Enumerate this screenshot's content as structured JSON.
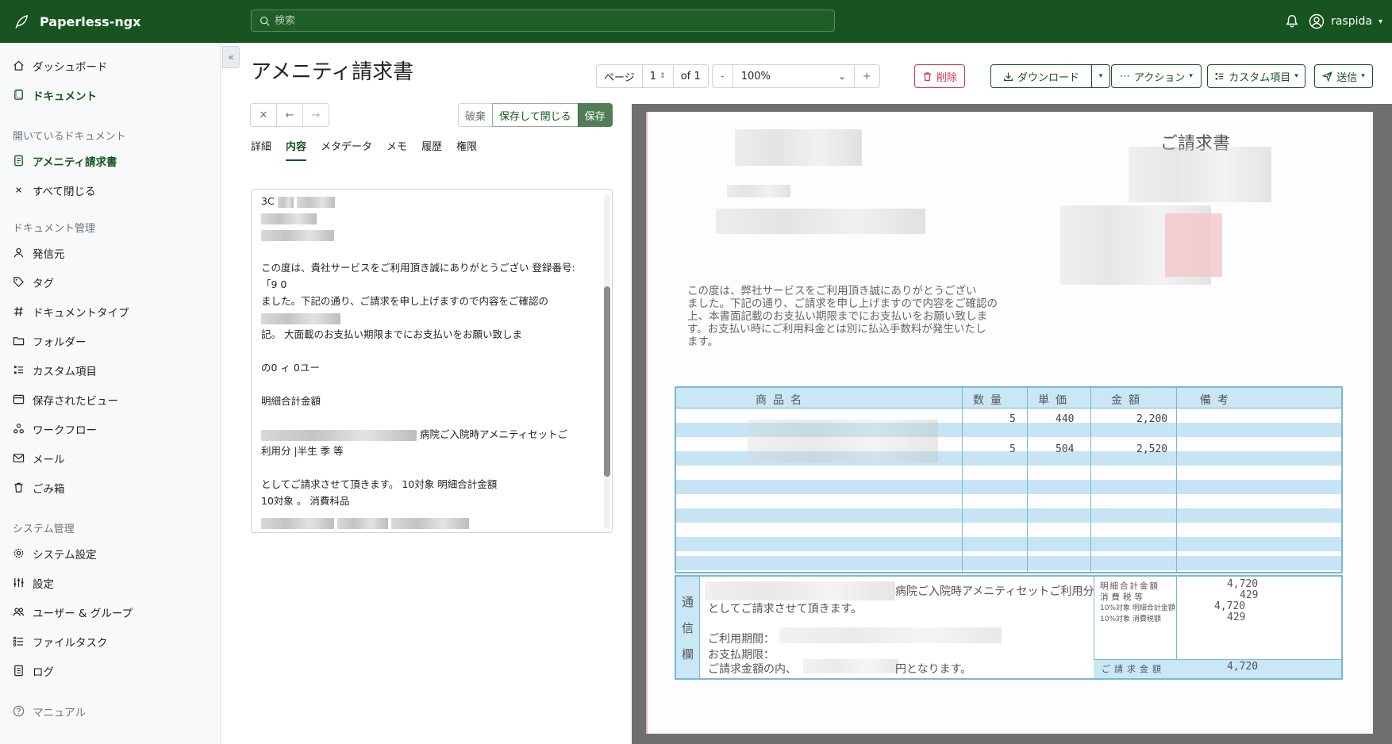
{
  "app": {
    "name": "Paperless-ngx"
  },
  "search": {
    "placeholder": "検索"
  },
  "user": {
    "name": "raspida"
  },
  "sidebar": {
    "top": [
      {
        "label": "ダッシュボード",
        "icon": "house-icon"
      },
      {
        "label": "ドキュメント",
        "icon": "document-icon"
      }
    ],
    "open_docs_header": "開いているドキュメント",
    "open_docs": [
      {
        "label": "アメニティ請求書",
        "icon": "file-text-icon"
      },
      {
        "label": "すべて閉じる",
        "icon": "close-icon"
      }
    ],
    "manage_header": "ドキュメント管理",
    "manage": [
      {
        "label": "発信元",
        "icon": "person-icon"
      },
      {
        "label": "タグ",
        "icon": "tag-icon"
      },
      {
        "label": "ドキュメントタイプ",
        "icon": "hash-icon"
      },
      {
        "label": "フォルダー",
        "icon": "folder-icon"
      },
      {
        "label": "カスタム項目",
        "icon": "custom-fields-icon"
      },
      {
        "label": "保存されたビュー",
        "icon": "saved-views-icon"
      },
      {
        "label": "ワークフロー",
        "icon": "workflow-icon"
      },
      {
        "label": "メール",
        "icon": "mail-icon"
      },
      {
        "label": "ごみ箱",
        "icon": "trash-icon"
      }
    ],
    "system_header": "システム管理",
    "system": [
      {
        "label": "システム設定",
        "icon": "gear-icon"
      },
      {
        "label": "設定",
        "icon": "sliders-icon"
      },
      {
        "label": "ユーザー & グループ",
        "icon": "people-icon"
      },
      {
        "label": "ファイルタスク",
        "icon": "list-task-icon"
      },
      {
        "label": "ログ",
        "icon": "log-icon"
      }
    ],
    "manual": {
      "label": "マニュアル",
      "icon": "question-icon"
    }
  },
  "document": {
    "title": "アメニティ請求書",
    "pager": {
      "page_label": "ページ",
      "page_value": "1",
      "of_label": "of 1"
    },
    "zoom": {
      "minus": "-",
      "value": "100%",
      "plus": "+"
    },
    "buttons": {
      "delete": "削除",
      "download": "ダウンロード",
      "actions": "アクション",
      "custom_fields": "カスタム項目",
      "send": "送信",
      "discard": "破棄",
      "save_close": "保存して閉じる",
      "save": "保存"
    },
    "tabs": [
      "詳細",
      "内容",
      "メタデータ",
      "メモ",
      "履歴",
      "権限"
    ],
    "active_tab": "内容",
    "content_lines": [
      "3C",
      "",
      "",
      "",
      "この度は、貴社サービスをご利用頂き誠にありがとうござい 登録番号:",
      "「9 0",
      "ました。下記の通り、ご請求を申し上げますので内容をご確認の",
      "",
      "記。 大面載のお支払い期限までにお支払いをお願い致しま",
      "",
      "の0 ィ 0ユー",
      "",
      "明細合計金額",
      "",
      "病院ご入院時アメニティセットご",
      "利用分 |半生 季 等",
      "",
      "としてご請求させて頂きます。 10対象 明細合計金額",
      "10対象 。 消費科品"
    ]
  },
  "invoice": {
    "title": "ご請求書",
    "body": [
      "この度は、弊社サービスをご利用頂き誠にありがとうござい",
      "ました。下記の通り、ご請求を申し上げますので内容をご確認の",
      "上、本書面記載のお支払い期限までにお支払いをお願い致しま",
      "す。お支払い時にご利用料金とは別に払込手数料が発生いたし",
      "ます。"
    ],
    "headers": [
      "商品名",
      "数量",
      "単価",
      "金額",
      "備考"
    ],
    "rows": [
      {
        "qty": "5",
        "unit": "440",
        "amount": "2,200"
      },
      {
        "qty": "5",
        "unit": "504",
        "amount": "2,520"
      }
    ],
    "comm_label": [
      "通",
      "信",
      "欄"
    ],
    "comm_lines": [
      "病院ご入院時アメニティセットご利用分",
      "としてご請求させて頂きます。",
      "ご利用期間：",
      "お支払期限：",
      "ご請求金額の内、",
      "円となります。"
    ],
    "summary_labels": [
      "明細合計金額",
      "消費税等",
      "10%対象 明細合計金額",
      "10%対象 消費税額"
    ],
    "summary_values": [
      "4,720",
      "429",
      "4,720",
      "429"
    ],
    "total_label": "ご請求金額",
    "total_value": "4,720"
  }
}
